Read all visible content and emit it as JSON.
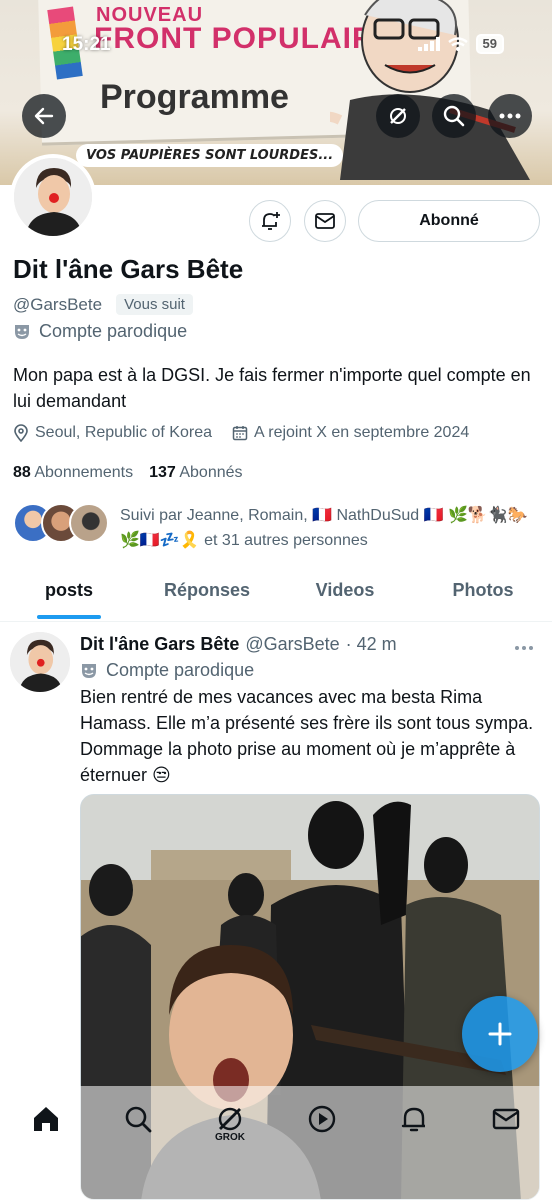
{
  "status_bar": {
    "time": "15:21",
    "battery": "59"
  },
  "banner": {
    "line1": "NOUVEAU",
    "line2": "FRONT POPULAIRE",
    "line3": "Programme",
    "bubble": "VOS PAUPIÈRES SONT LOURDES..."
  },
  "profile": {
    "display_name": "Dit l'âne Gars Bête",
    "handle": "@GarsBete",
    "follows_you": "Vous suit",
    "parody_label": "Compte parodique",
    "bio": "Mon papa est à la DGSI. Je fais fermer n'importe quel compte en lui demandant",
    "location": "Seoul, Republic of Korea",
    "joined": "A rejoint X en septembre 2024",
    "following_count": "88",
    "following_label": "Abonnements",
    "followers_count": "137",
    "followers_label": "Abonnés",
    "follow_button": "Abonné",
    "followed_by": "Suivi par Jeanne, Romain, 🇫🇷 NathDuSud 🇫🇷 🌿🐕🐈‍⬛🐎🌿🇫🇷💤🎗️ et 31 autres personnes"
  },
  "tabs": [
    {
      "label": "posts"
    },
    {
      "label": "Réponses"
    },
    {
      "label": "Videos"
    },
    {
      "label": "Photos"
    }
  ],
  "post": {
    "author_name": "Dit l'âne Gars Bête",
    "author_handle": "@GarsBete",
    "time": "· 42 m",
    "parody_label": "Compte parodique",
    "text": "Bien rentré de mes vacances avec ma besta Rima Hamass. Elle m’a présenté ses frère ils sont tous sympa. Dommage la photo prise au moment où je m’apprête à éternuer 😒"
  },
  "bottom_nav": {
    "grok_label": "GROK"
  },
  "colors": {
    "accent": "#1d9bf0",
    "text": "#0f1419",
    "secondary": "#536471",
    "border": "#cfd9de"
  }
}
